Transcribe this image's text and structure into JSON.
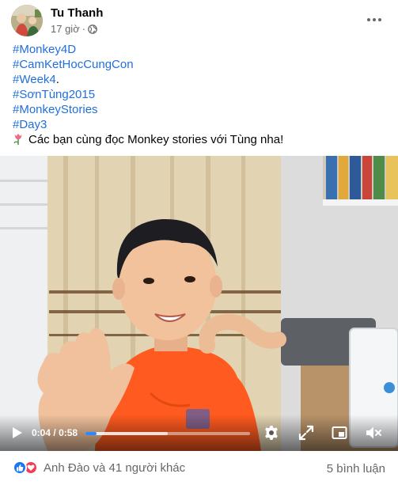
{
  "post": {
    "author": "Tu Thanh",
    "time": "17 giờ",
    "separator": "·",
    "privacy_icon": "globe-icon",
    "more_icon": "more-horizontal-icon"
  },
  "text": {
    "hashtags": [
      "#Monkey4D",
      "#CamKetHocCungCon",
      "#Week4",
      "#SơnTùng2015",
      "#MonkeyStories",
      "#Day3"
    ],
    "week4_suffix": ".",
    "message": "Các bạn cùng đọc Monkey stories với Tùng nha!",
    "message_icon": "tulip-icon"
  },
  "video": {
    "current_time": "0:04",
    "separator": "/",
    "duration": "0:58",
    "progress_fraction": 0.069,
    "buffered_fraction": 0.5,
    "icons": [
      "play-icon",
      "gear-icon",
      "expand-icon",
      "pip-icon",
      "mute-icon"
    ]
  },
  "footer": {
    "reactors": "Anh Đào và 41 người khác",
    "comments": "5 bình luận",
    "reaction_icons": [
      "like-icon",
      "love-icon"
    ]
  },
  "colors": {
    "hashtag": "#216fdb",
    "like": "#1877f2",
    "love": "#f33e58",
    "progress": "#2d88ff",
    "secondary_text": "#65676b"
  }
}
